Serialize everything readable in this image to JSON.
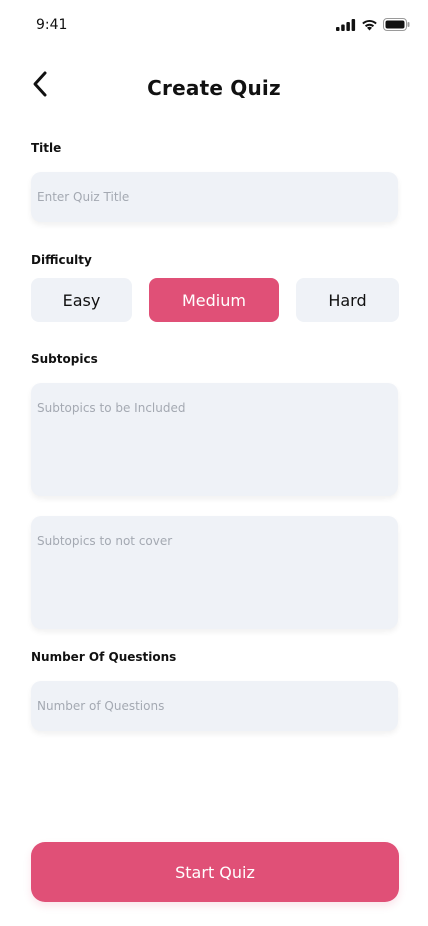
{
  "status_bar": {
    "time": "9:41",
    "icons": [
      "signal-icon",
      "wifi-icon",
      "battery-icon"
    ]
  },
  "header": {
    "title": "Create Quiz",
    "back_icon": "chevron-left-icon"
  },
  "title_section": {
    "label": "Title",
    "placeholder": "Enter Quiz Title",
    "value": ""
  },
  "difficulty": {
    "label": "Difficulty",
    "options": [
      "Easy",
      "Medium",
      "Hard"
    ],
    "selected": "Medium"
  },
  "subtopics": {
    "label": "Subtopics",
    "include_placeholder": "Subtopics to be Included",
    "exclude_placeholder": "Subtopics to not cover"
  },
  "questions": {
    "label": "Number Of Questions",
    "placeholder": "Number of Questions",
    "value": ""
  },
  "submit": {
    "label": "Start Quiz"
  },
  "colors": {
    "accent": "#e05077",
    "field_bg": "#eff2f7",
    "placeholder": "#a4a9b2",
    "text": "#111111"
  }
}
